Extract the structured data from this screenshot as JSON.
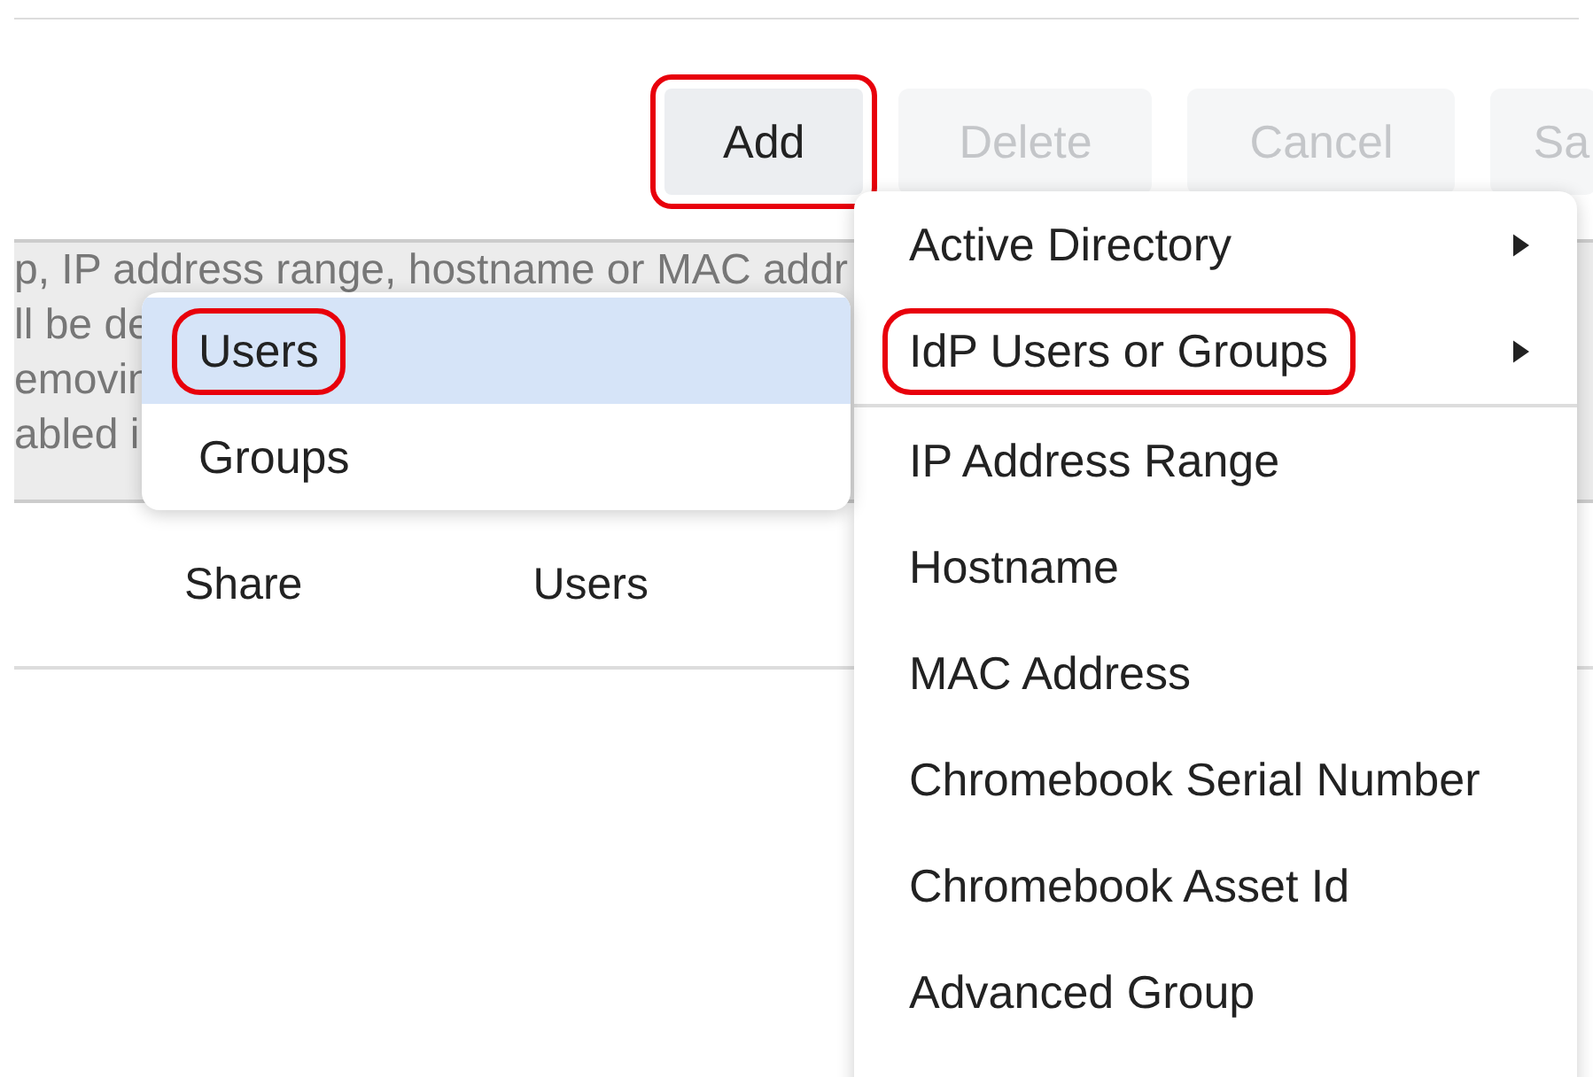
{
  "toolbar": {
    "buttons": [
      {
        "label": "Add",
        "disabled": false,
        "annotated": true
      },
      {
        "label": "Delete",
        "disabled": true,
        "annotated": false
      },
      {
        "label": "Cancel",
        "disabled": true,
        "annotated": false
      },
      {
        "label": "Sa",
        "disabled": true,
        "annotated": false
      }
    ]
  },
  "notice": {
    "lines": [
      "p, IP address range, hostname or MAC addr",
      "ll be de",
      "emovin",
      "abled i"
    ]
  },
  "table": {
    "columns": [
      "Share",
      "Users"
    ]
  },
  "add_menu": {
    "items": [
      {
        "label": "Active Directory",
        "submenu": true,
        "annotated": false,
        "divider_after": false
      },
      {
        "label": "IdP Users or Groups",
        "submenu": true,
        "annotated": true,
        "divider_after": true
      },
      {
        "label": "IP Address Range",
        "submenu": false,
        "annotated": false,
        "divider_after": false
      },
      {
        "label": "Hostname",
        "submenu": false,
        "annotated": false,
        "divider_after": false
      },
      {
        "label": "MAC Address",
        "submenu": false,
        "annotated": false,
        "divider_after": false
      },
      {
        "label": "Chromebook Serial Number",
        "submenu": false,
        "annotated": false,
        "divider_after": false
      },
      {
        "label": "Chromebook Asset Id",
        "submenu": false,
        "annotated": false,
        "divider_after": false
      },
      {
        "label": "Advanced Group",
        "submenu": false,
        "annotated": false,
        "divider_after": false
      }
    ]
  },
  "idp_submenu": {
    "items": [
      {
        "label": "Users",
        "selected": true,
        "annotated": true
      },
      {
        "label": "Groups",
        "selected": false,
        "annotated": false
      }
    ]
  }
}
